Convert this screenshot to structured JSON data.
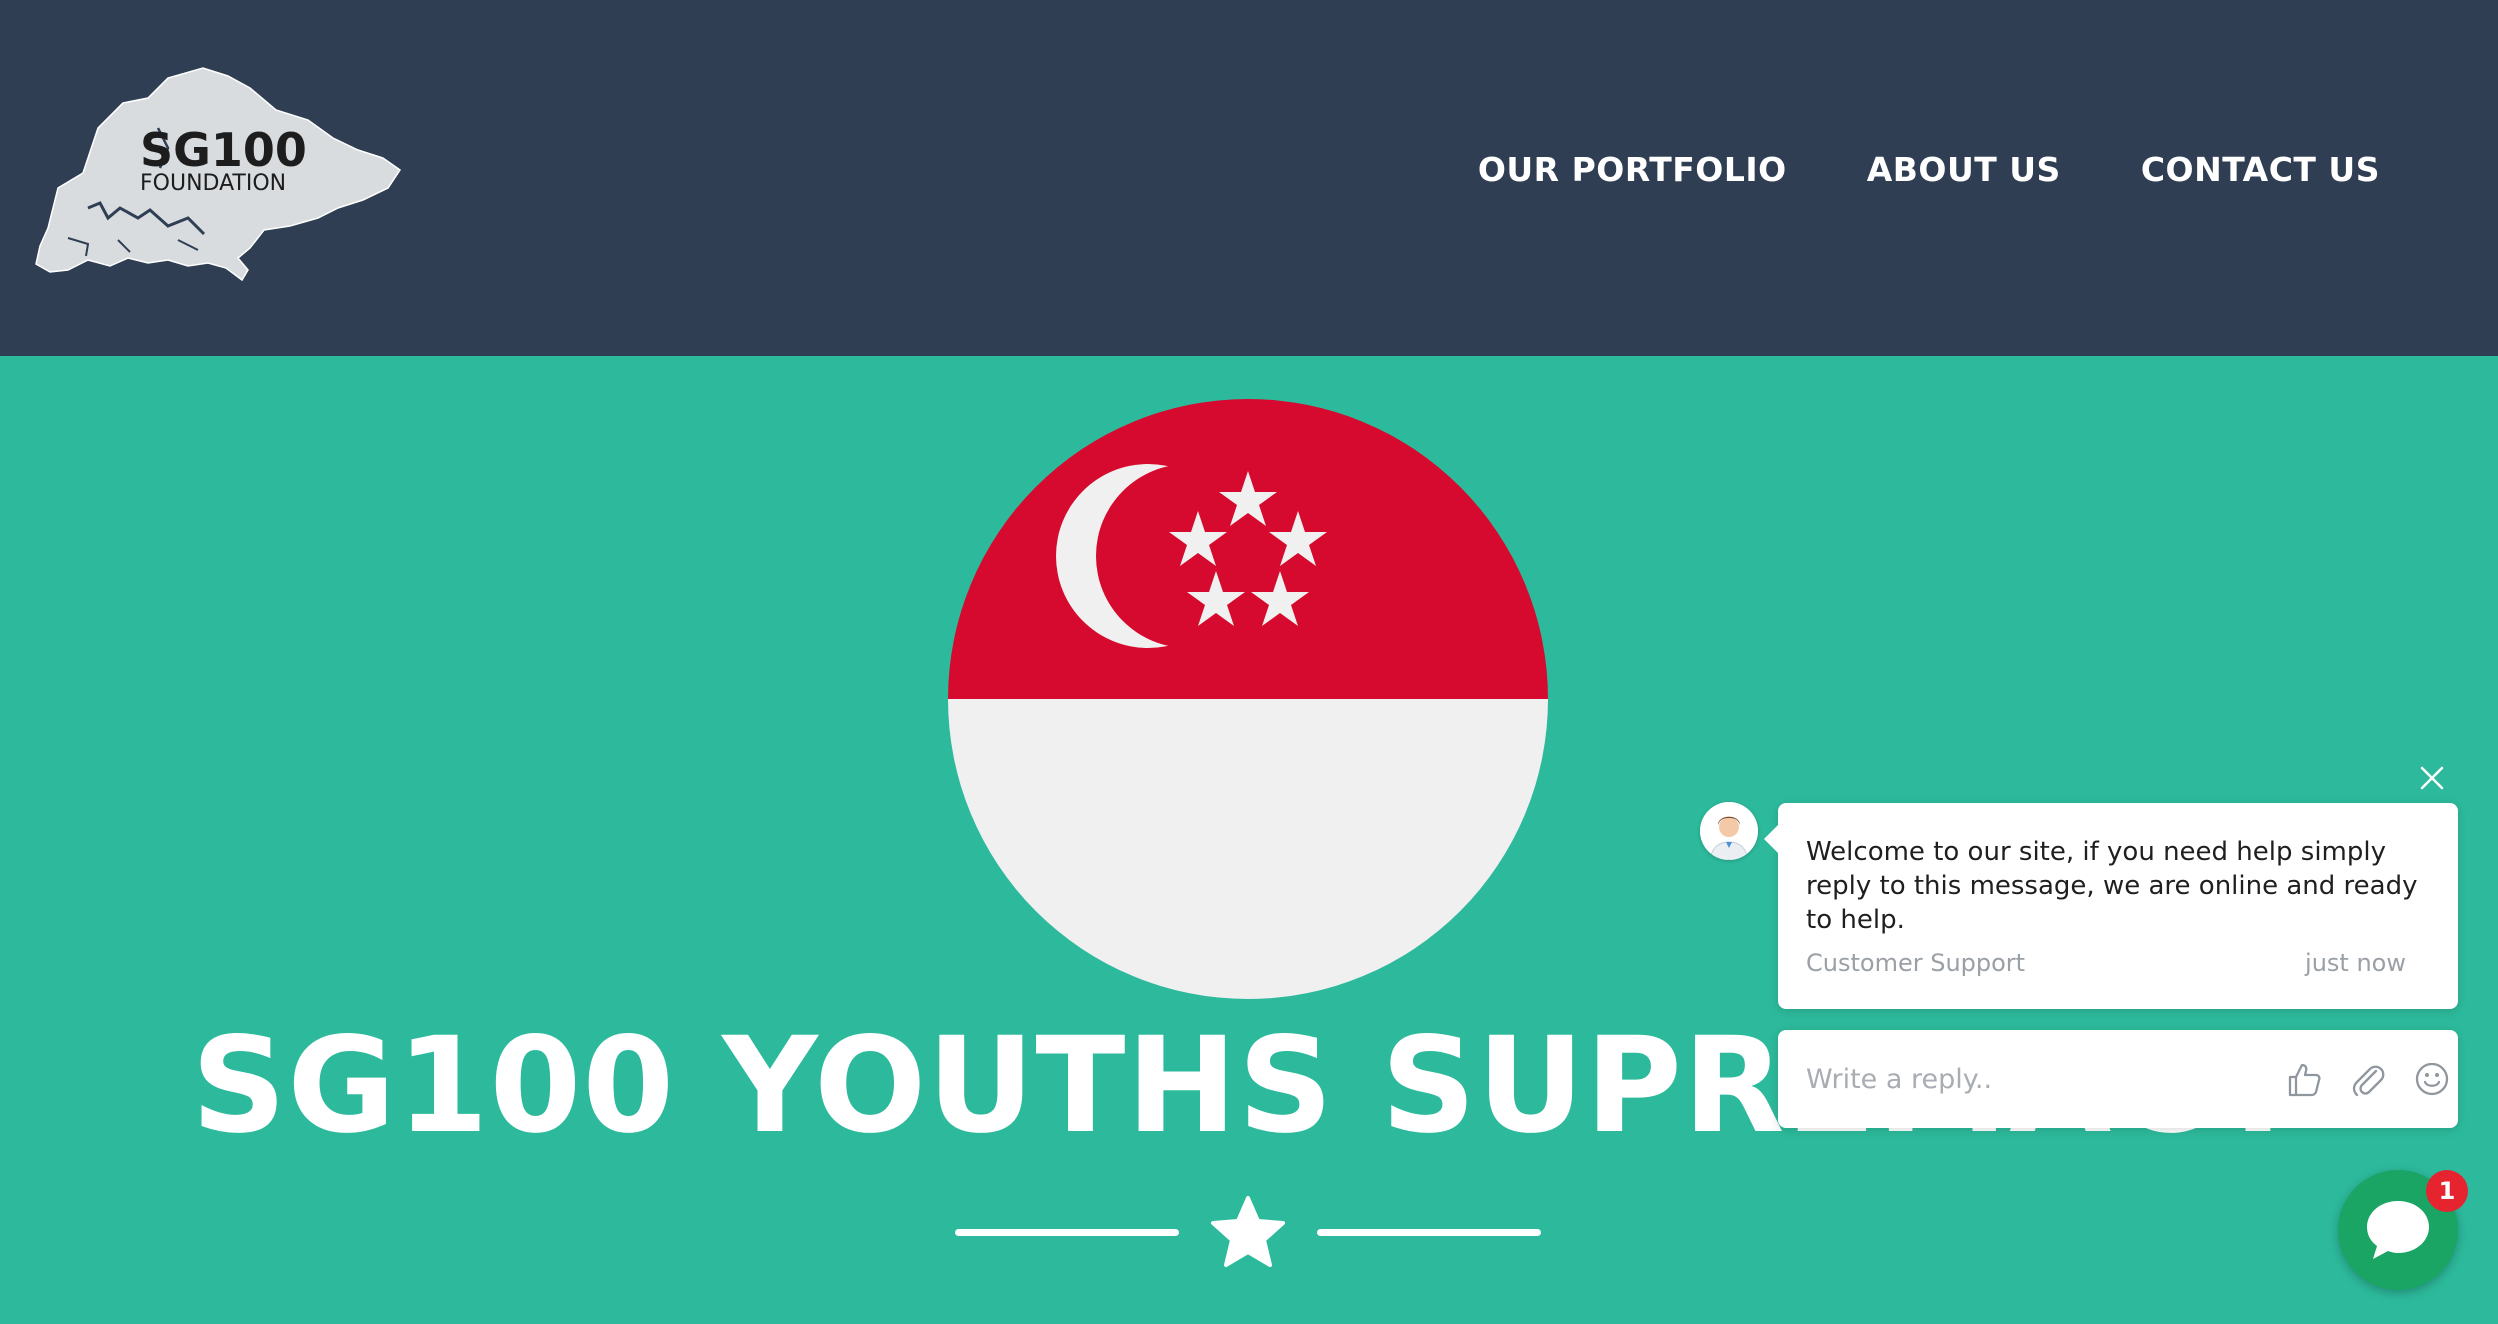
{
  "header": {
    "logo_text_main": "SG100",
    "logo_text_sub": "FOUNDATION",
    "nav": [
      {
        "label": "OUR PORTFOLIO"
      },
      {
        "label": "ABOUT US"
      },
      {
        "label": "CONTACT US"
      }
    ]
  },
  "hero": {
    "title": "SG100 YOUTHS SUPREMACY"
  },
  "chat": {
    "message": "Welcome to our site, if you need help simply reply to this message, we are online and ready to help.",
    "author": "Customer Support",
    "time": "just now",
    "reply_placeholder": "Write a reply..",
    "unread_count": "1",
    "icons": [
      "close-icon",
      "thumbs-up-icon",
      "paperclip-icon",
      "smiley-icon",
      "chat-bubble-icon"
    ]
  },
  "colors": {
    "header_bg": "#2f3e53",
    "hero_bg": "#2dba9c",
    "flag_red": "#d50a2e",
    "flag_white": "#f0f0f0",
    "launcher_green": "#1aa564",
    "badge_red": "#e5242f"
  }
}
